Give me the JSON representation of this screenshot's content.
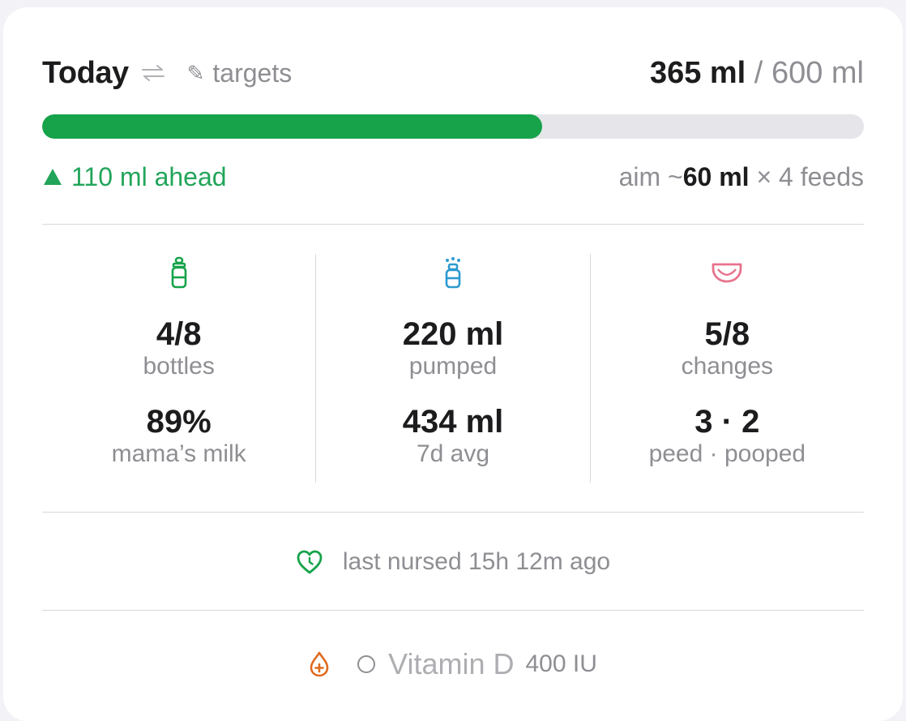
{
  "header": {
    "title": "Today",
    "targets_label": "targets",
    "consumed": "365 ml",
    "separator": " / ",
    "target": "600 ml"
  },
  "progress": {
    "fraction": 0.608,
    "color": "#16a34a"
  },
  "status": {
    "ahead": "110 ml ahead",
    "aim_prefix": "aim ~",
    "aim_amount": "60 ml",
    "aim_suffix": " × 4 feeds"
  },
  "stats": {
    "bottles": {
      "icon": "bottle-icon",
      "value": "4/8",
      "label": "bottles",
      "value2": "89%",
      "label2": "mama’s milk"
    },
    "pumped": {
      "icon": "breast-pump-icon",
      "value": "220 ml",
      "label": "pumped",
      "value2": "434 ml",
      "label2": "7d avg"
    },
    "changes": {
      "icon": "diaper-icon",
      "value": "5/8",
      "label": "changes",
      "value2": "3 · 2",
      "label2": "peed · pooped"
    }
  },
  "nursed": {
    "icon": "heart-clock-icon",
    "text": "last nursed 15h 12m ago"
  },
  "vitamin": {
    "icon": "medicine-drop-icon",
    "name": "Vitamin D",
    "dose": "400 IU"
  },
  "colors": {
    "accent_green": "#16a34a",
    "pump_blue": "#2b9ad0",
    "diaper_pink": "#e7738c",
    "vitamin_orange": "#e0691f"
  }
}
